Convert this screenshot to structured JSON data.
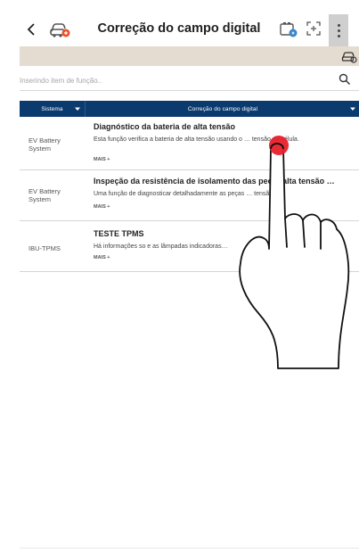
{
  "header": {
    "back_icon": "chevron-left-icon",
    "vehicle_icon": "car-diagnostic-icon",
    "title": "Correção do campo digital",
    "action_icon_1": "vehicle-battery-icon",
    "action_icon_2": "fullscreen-icon",
    "menu_icon": "kebab-menu-icon"
  },
  "toolbar": {
    "right_icon": "car-settings-icon",
    "background": "#e4dcd1"
  },
  "search": {
    "placeholder": "Inserindo item de função..",
    "icon": "search-icon"
  },
  "table": {
    "header_color": "#0a3a6e",
    "columns": [
      {
        "label": "Sistema",
        "has_dropdown": true
      },
      {
        "label": "Correção do campo digital",
        "has_dropdown": true
      }
    ],
    "rows": [
      {
        "system": "EV Battery System",
        "title": "Diagnóstico da bateria de alta tensão",
        "description": "Esta função verifica a bateria de alta tensão usando o … tensão de célula.",
        "more": "MAIS +"
      },
      {
        "system": "EV Battery System",
        "title": "Inspeção da resistência de isolamento das peç… alta tensão …",
        "description": "Uma função de diagnosticar detalhadamente as peças … tensão.",
        "more": "MAIS +"
      },
      {
        "system": "IBU-TPMS",
        "title": "TESTE TPMS",
        "description": "Há informações so e as lâmpadas indicadoras…",
        "more": "MAIS +"
      }
    ]
  },
  "overlay": {
    "touch_indicator_color": "#e8202a",
    "icon": "pointing-hand-icon"
  }
}
